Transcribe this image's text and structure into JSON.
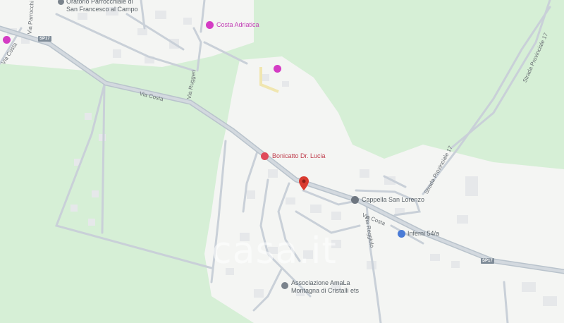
{
  "map": {
    "colors": {
      "land": "#d6efd6",
      "urban": "#f4f5f3",
      "road": "#c9d0d8",
      "road_major": "#b9c3cc",
      "building": "#e6e8ea",
      "shopping": "#d43cc4",
      "health": "#e0495b",
      "pin": "#d93b30",
      "worship": "#6e7680",
      "parking": "#4a7bd6"
    },
    "places": {
      "oratorio": "Oratorio Parrocchiale di\nSan Francesco al Campo",
      "costa_adriatica": "Costa Adriatica",
      "bonicatto": "Bonicatto Dr. Lucia",
      "cappella": "Cappella San Lorenzo",
      "inferni": "Inferni 54/a",
      "associazione_line1": "Associazione AmaLa",
      "associazione_line2": "Montagna di Cristalli ets"
    },
    "roads": {
      "via_costa_1": "Via Costa",
      "via_costa_2": "Via Costa",
      "via_costa_top": "Via Costa",
      "via_ruggeri": "Via Ruggeri",
      "via_parrocchia": "Via Parrocchi",
      "via_reg": "Via Reggiolo",
      "strada_prov_17": "Strada Provinciale 17",
      "strada_prov_17b": "Strada Provinciale 17",
      "sp17_a": "SP17",
      "sp17_b": "SP17"
    },
    "icons": {
      "shopping": "shopping-bag-icon",
      "health": "medical-icon",
      "worship": "church-icon",
      "parking": "parking-icon",
      "pin": "location-pin-icon"
    },
    "watermark": "casa.it"
  }
}
